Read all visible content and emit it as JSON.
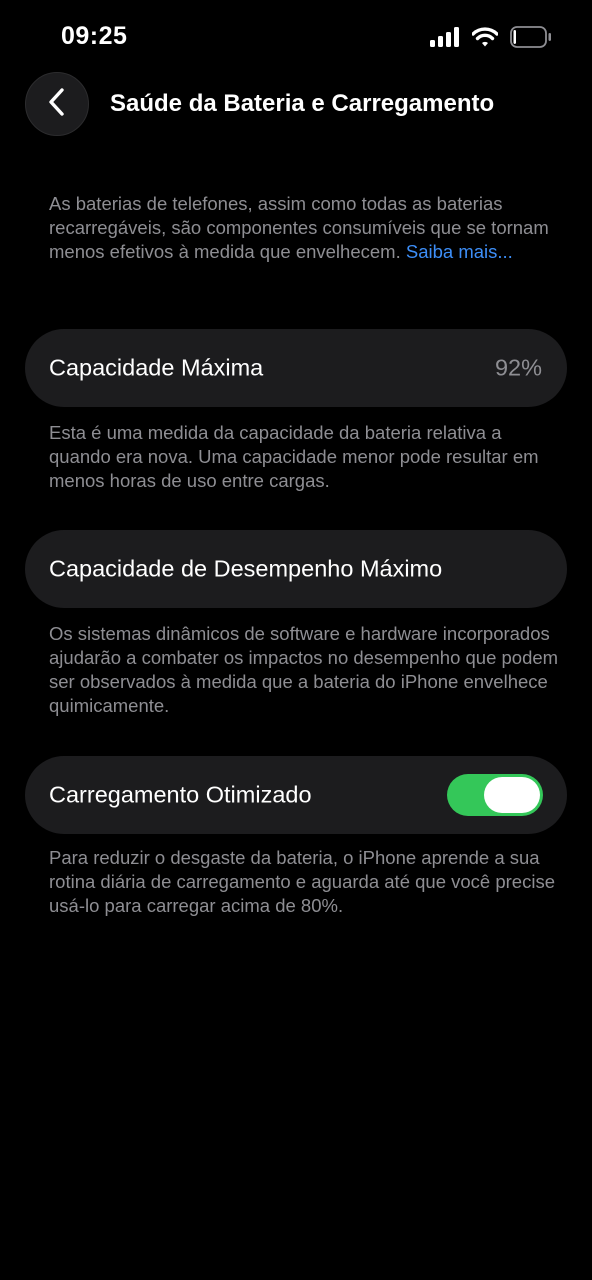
{
  "status_bar": {
    "time": "09:25",
    "icons": [
      "signal-icon",
      "wifi-icon",
      "battery-icon"
    ]
  },
  "header": {
    "title": "Saúde da Bateria e Carregamento",
    "back_icon": "chevron-left-icon"
  },
  "intro": {
    "text": "As baterias de telefones, assim como todas as baterias recarregáveis, são componentes consumíveis que se tornam menos efetivos à medida que envelhecem.",
    "link": "Saiba mais..."
  },
  "max_capacity": {
    "label": "Capacidade Máxima",
    "value": "92%",
    "description": "Esta é uma medida da capacidade da bateria relativa a quando era nova. Uma capacidade menor pode resultar em menos horas de uso entre cargas."
  },
  "peak_performance": {
    "label": "Capacidade de Desempenho Máximo",
    "description": "Os sistemas dinâmicos de software e hardware incorporados ajudarão a combater os impactos no desempenho que podem ser observados à medida que a bateria do iPhone envelhece quimicamente."
  },
  "optimized_charging": {
    "label": "Carregamento Otimizado",
    "enabled": true,
    "description": "Para reduzir o desgaste da bateria, o iPhone aprende a sua rotina diária de carregamento e aguarda até que você precise usá-lo para carregar acima de 80%."
  },
  "colors": {
    "background": "#000000",
    "card": "#1c1c1e",
    "secondary_text": "#8e8e93",
    "link": "#3d8ef7",
    "toggle_on": "#34c759"
  }
}
